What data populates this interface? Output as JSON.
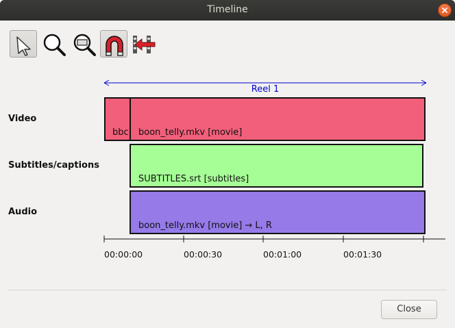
{
  "window": {
    "title": "Timeline"
  },
  "toolbar": {
    "tools": [
      {
        "name": "select",
        "icon": "arrow-pointer-icon",
        "active": true
      },
      {
        "name": "zoom",
        "icon": "magnifier-icon",
        "active": false
      },
      {
        "name": "zoom-fit",
        "icon": "magnifier-rect-icon",
        "active": false
      },
      {
        "name": "snap",
        "icon": "magnet-icon",
        "active": true
      },
      {
        "name": "sequence",
        "icon": "sequence-arrow-icon",
        "active": false
      }
    ]
  },
  "reel": {
    "label": "Reel 1",
    "color": "#0000cc"
  },
  "tracks": {
    "video": "Video",
    "subtitles": "Subtitles/captions",
    "audio": "Audio"
  },
  "clips": {
    "video_small": {
      "label": "bbc",
      "color": "#f25f7a"
    },
    "video_main": {
      "label": "boon_telly.mkv [movie]",
      "color": "#f25f7a"
    },
    "subtitles": {
      "label": "SUBTITLES.srt [subtitles]",
      "color": "#a6ff96"
    },
    "audio": {
      "label": "boon_telly.mkv [movie] → L, R",
      "color": "#957ae8"
    }
  },
  "ruler": {
    "ticks": [
      "00:00:00",
      "00:00:30",
      "00:01:00",
      "00:01:30"
    ]
  },
  "buttons": {
    "close": "Close"
  }
}
